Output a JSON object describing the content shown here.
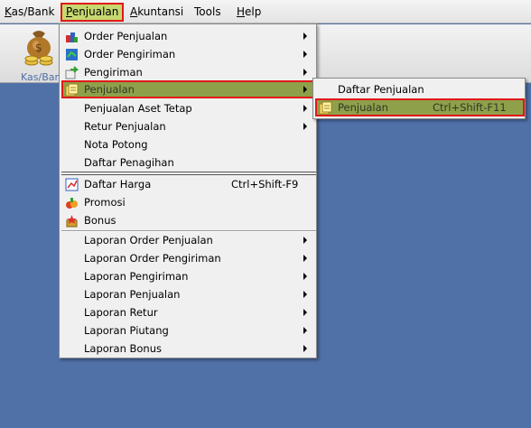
{
  "menubar": {
    "items": [
      {
        "label": "Kas/Bank",
        "u": "K",
        "rest": "as/Bank"
      },
      {
        "label": "Penjualan",
        "u": "P",
        "rest": "enjualan"
      },
      {
        "label": "Akuntansi",
        "u": "A",
        "rest": "kuntansi"
      },
      {
        "label": "Tools",
        "u": "T",
        "rest": "ools"
      },
      {
        "label": "Help",
        "u": "H",
        "rest": "elp"
      }
    ]
  },
  "toolbar": {
    "kas_bank_label": "Kas/Bank"
  },
  "penjualan_menu": {
    "items": [
      {
        "label": "Order Penjualan",
        "icon": "order-icon",
        "submenu": true
      },
      {
        "label": "Order Pengiriman",
        "icon": "delivery-order-icon",
        "submenu": true
      },
      {
        "label": "Pengiriman",
        "icon": "shipping-icon",
        "submenu": true
      },
      {
        "label": "Penjualan",
        "icon": "sales-invoice-icon",
        "submenu": true
      },
      {
        "label": "Penjualan Aset Tetap",
        "submenu": true
      },
      {
        "label": "Retur Penjualan",
        "submenu": true
      },
      {
        "label": "Nota Potong"
      },
      {
        "label": "Daftar Penagihan"
      },
      {
        "label": "Daftar Harga",
        "icon": "price-list-icon",
        "shortcut": "Ctrl+Shift-F9"
      },
      {
        "label": "Promosi",
        "icon": "promo-icon"
      },
      {
        "label": "Bonus",
        "icon": "bonus-icon"
      },
      {
        "label": "Laporan Order Penjualan",
        "submenu": true
      },
      {
        "label": "Laporan Order Pengiriman",
        "submenu": true
      },
      {
        "label": "Laporan Pengiriman",
        "submenu": true
      },
      {
        "label": "Laporan Penjualan",
        "submenu": true
      },
      {
        "label": "Laporan Retur",
        "submenu": true
      },
      {
        "label": "Laporan Piutang",
        "submenu": true
      },
      {
        "label": "Laporan Bonus",
        "submenu": true
      }
    ]
  },
  "penjualan_submenu": {
    "items": [
      {
        "label": "Daftar Penjualan"
      },
      {
        "label": "Penjualan",
        "icon": "sales-invoice-icon",
        "shortcut": "Ctrl+Shift-F11"
      }
    ]
  },
  "colors": {
    "desktop": "#5070a8",
    "highlight": "#8ea04a",
    "annotation_border": "#e01818"
  }
}
